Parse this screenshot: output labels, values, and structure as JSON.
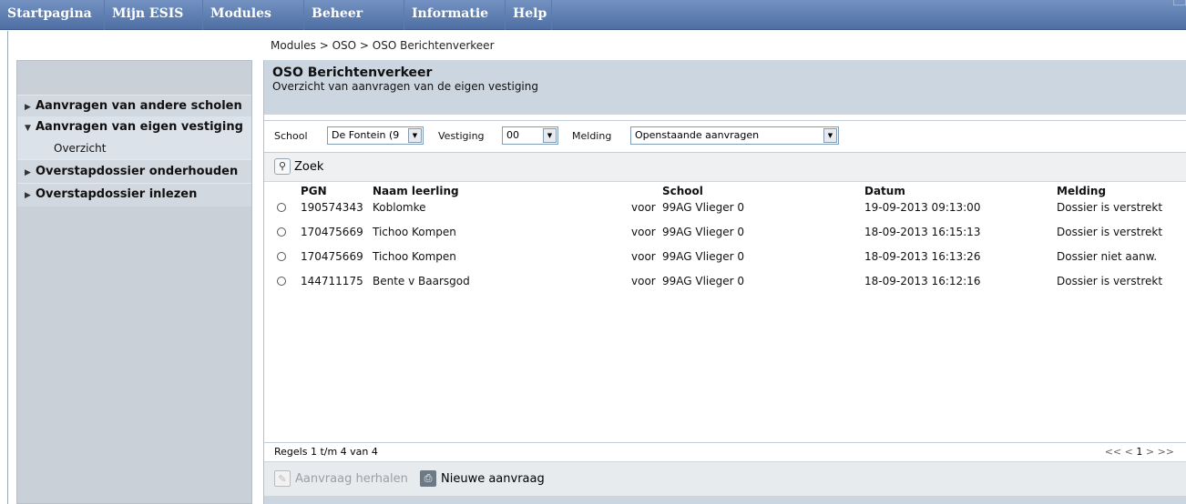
{
  "nav": {
    "items": [
      "Startpagina",
      "Mijn ESIS",
      "Modules",
      "Beheer",
      "Informatie",
      "Help"
    ]
  },
  "breadcrumb": "Modules > OSO > OSO Berichtenverkeer",
  "sidebar": {
    "items": [
      {
        "label": "Aanvragen van andere scholen",
        "icon": "collapsed-arrow"
      },
      {
        "label": "Aanvragen van eigen vestiging",
        "icon": "expanded-arrow"
      },
      {
        "label": "Overstapdossier onderhouden",
        "icon": "collapsed-arrow"
      },
      {
        "label": "Overstapdossier inlezen",
        "icon": "collapsed-arrow"
      }
    ],
    "subitem": "Overzicht"
  },
  "header": {
    "title": "OSO Berichtenverkeer",
    "subtitle": "Overzicht van aanvragen van de eigen vestiging"
  },
  "filters": {
    "school_label": "School",
    "school_value": "De Fontein (9",
    "vestiging_label": "Vestiging",
    "vestiging_value": "00",
    "melding_label": "Melding",
    "melding_value": "Openstaande aanvragen"
  },
  "search": {
    "label": "Zoek",
    "icon": "magnifier-icon"
  },
  "table": {
    "columns": [
      "PGN",
      "Naam leerling",
      "School",
      "Datum",
      "Melding"
    ],
    "rows": [
      {
        "pgn": "190574343",
        "naam": "Koblomke",
        "voor": "voor",
        "school": "99AG Vlieger 0",
        "datum": "19-09-2013 09:13:00",
        "melding": "Dossier is verstrekt"
      },
      {
        "pgn": "170475669",
        "naam": "Tichoo Kompen",
        "voor": "voor",
        "school": "99AG Vlieger 0",
        "datum": "18-09-2013 16:15:13",
        "melding": "Dossier is verstrekt"
      },
      {
        "pgn": "170475669",
        "naam": "Tichoo Kompen",
        "voor": "voor",
        "school": "99AG Vlieger 0",
        "datum": "18-09-2013 16:13:26",
        "melding": "Dossier niet aanw."
      },
      {
        "pgn": "144711175",
        "naam": "Bente v Baarsgod",
        "voor": "voor",
        "school": "99AG Vlieger 0",
        "datum": "18-09-2013 16:12:16",
        "melding": "Dossier is verstrekt"
      }
    ]
  },
  "footer": {
    "regels": "Regels 1 t/m 4 van 4",
    "pager_first": "<<",
    "pager_prev": "<",
    "pager_page": "1",
    "pager_next": ">",
    "pager_last": ">>"
  },
  "actions": {
    "herhalen": "Aanvraag herhalen",
    "nieuwe": "Nieuwe aanvraag"
  },
  "colors": {
    "nav_bg": "#5b7bb0",
    "sidebar_bg": "#c9d0d8",
    "header_bg": "#ccd6e0"
  }
}
